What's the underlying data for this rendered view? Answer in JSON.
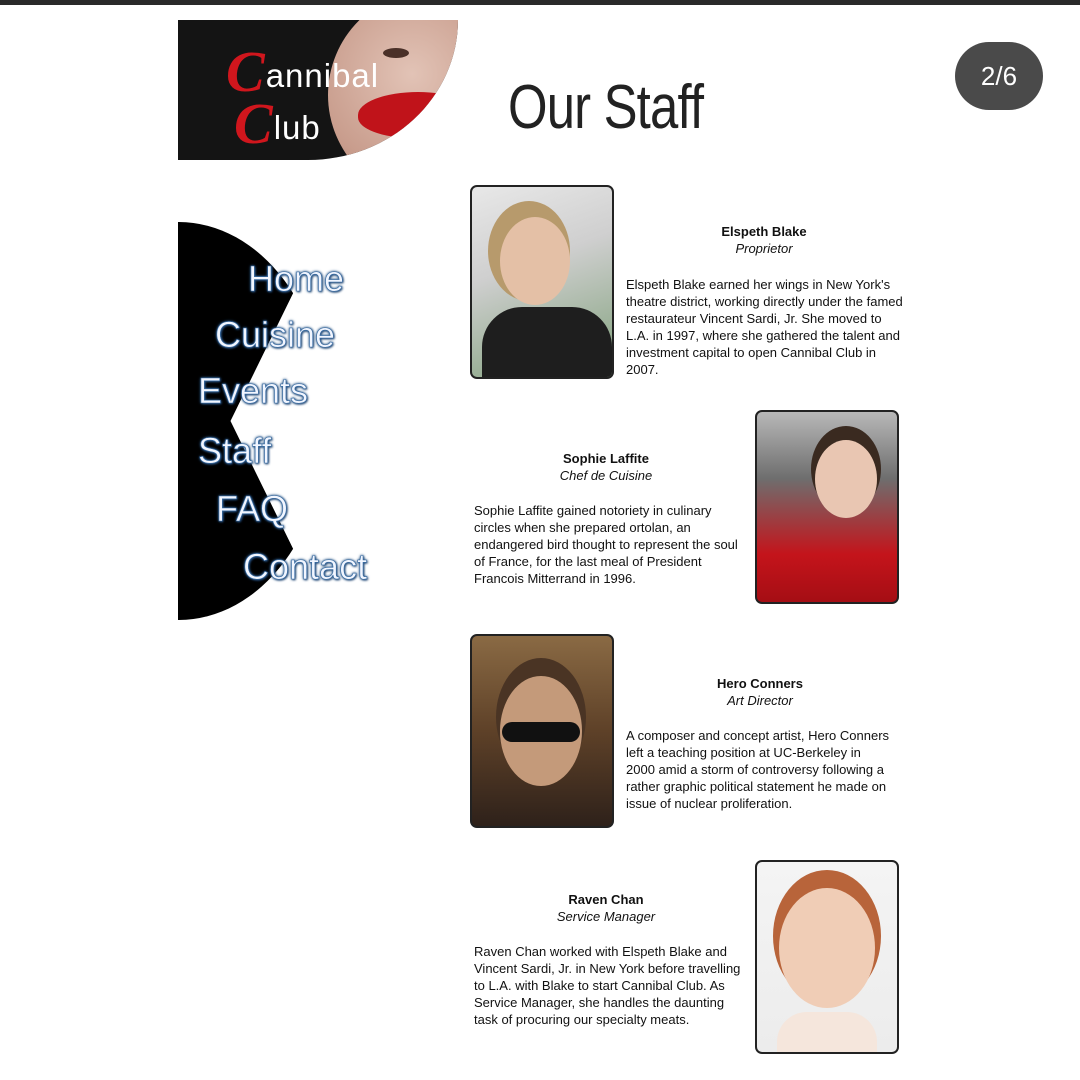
{
  "logo": {
    "cap1": "C",
    "word1": "annibal",
    "cap2": "C",
    "word2": "lub"
  },
  "page": {
    "title": "Our Staff",
    "badge": "2/6"
  },
  "nav": {
    "items": [
      "Home",
      "Cuisine",
      "Events",
      "Staff",
      "FAQ",
      "Contact"
    ]
  },
  "staff": [
    {
      "name": "Elspeth Blake",
      "role": "Proprietor",
      "bio": "Elspeth Blake earned her wings in New York's theatre district, working directly under the famed restaurateur Vincent Sardi, Jr. She moved to L.A. in 1997, where she gathered the talent and investment capital to open Cannibal Club in 2007."
    },
    {
      "name": "Sophie Laffite",
      "role": "Chef de Cuisine",
      "bio": "Sophie Laffite gained notoriety in culinary circles when she prepared ortolan, an endangered bird thought to represent the soul of France, for the last meal of President Francois Mitterrand in 1996."
    },
    {
      "name": "Hero Conners",
      "role": "Art Director",
      "bio": "A composer and concept artist, Hero Conners left a teaching position at UC-Berkeley in 2000 amid a storm of controversy following a rather graphic political statement he made on issue of nuclear proliferation."
    },
    {
      "name": "Raven Chan",
      "role": "Service Manager",
      "bio": "Raven Chan worked with Elspeth Blake and Vincent Sardi, Jr. in New York before travelling to L.A. with Blake to start Cannibal Club. As Service Manager, she handles the daunting task of procuring our specialty meats."
    }
  ]
}
